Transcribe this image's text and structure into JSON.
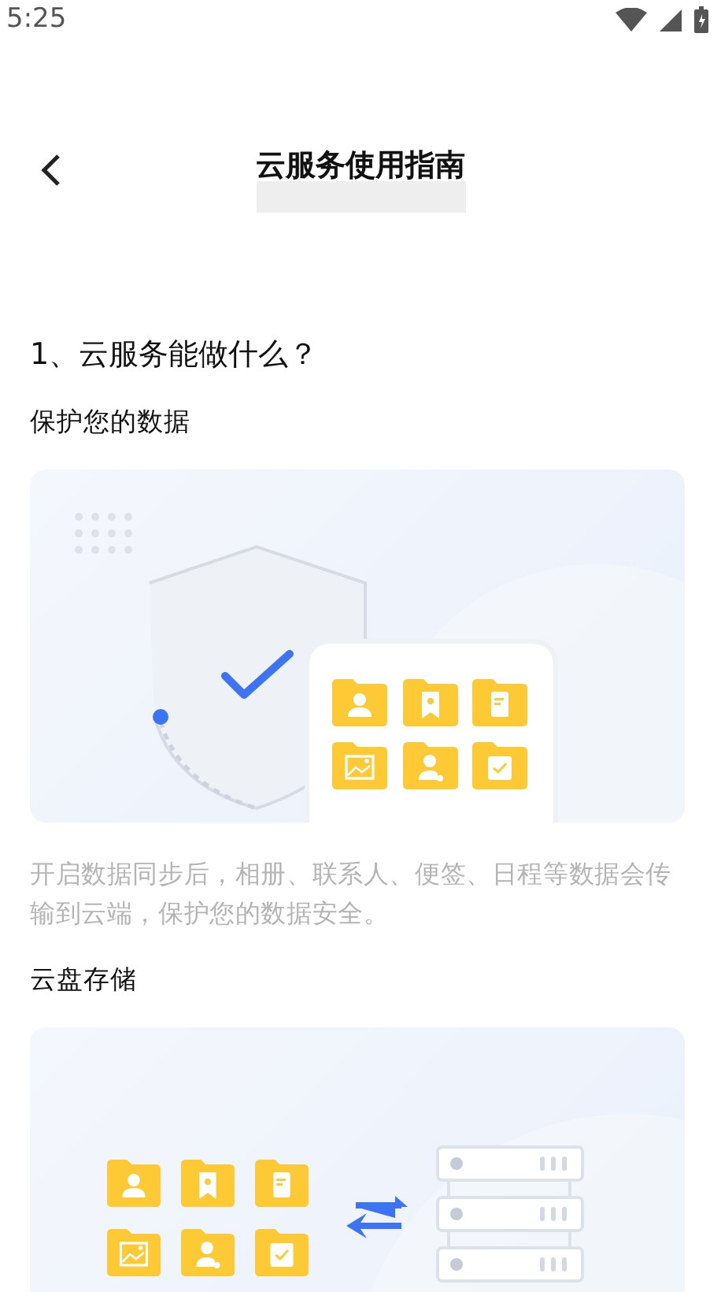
{
  "status_bar": {
    "time": "5:25"
  },
  "header": {
    "title": "云服务使用指南"
  },
  "section": {
    "heading": "1、云服务能做什么？",
    "features": [
      {
        "kind": "protect",
        "title": "保护您的数据",
        "description": "开启数据同步后，相册、联系人、便签、日程等数据会传输到云端，保护您的数据安全。"
      },
      {
        "kind": "storage",
        "title": "云盘存储"
      }
    ]
  }
}
